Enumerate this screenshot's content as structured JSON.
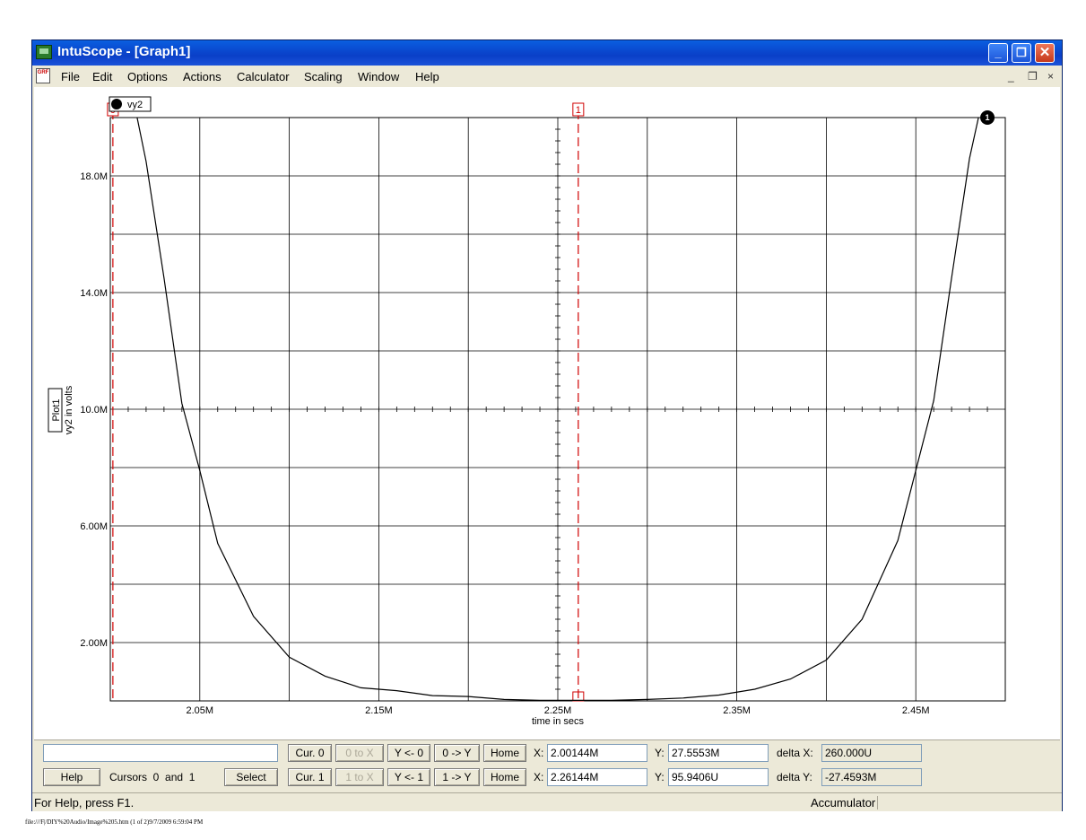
{
  "window": {
    "title": "IntuScope - [Graph1]",
    "controls": {
      "minimize": "_",
      "restore": "❐",
      "close": "✕"
    },
    "mdi_controls": {
      "minimize": "_",
      "restore": "❐",
      "close": "×"
    }
  },
  "menu": [
    "File",
    "Edit",
    "Options",
    "Actions",
    "Calculator",
    "Scaling",
    "Window",
    "Help"
  ],
  "graph": {
    "trace_label": "vy2",
    "trace_marker": "1",
    "plot_name": "Plot1",
    "y_axis_label": "vy2 in volts",
    "x_axis_label": "time in secs",
    "cursor0_label": "0",
    "cursor1_label": "1"
  },
  "chart_data": {
    "type": "line",
    "xlabel": "time in secs",
    "ylabel": "vy2 in volts",
    "xlim": [
      2.0,
      2.5
    ],
    "ylim": [
      0,
      20.0
    ],
    "x_tick_labels": [
      "2.05M",
      "2.15M",
      "2.25M",
      "2.35M",
      "2.45M"
    ],
    "x_tick_values": [
      2.05,
      2.15,
      2.25,
      2.35,
      2.45
    ],
    "y_tick_labels": [
      "2.00M",
      "6.00M",
      "10.0M",
      "14.0M",
      "18.0M"
    ],
    "y_tick_values": [
      2.0,
      6.0,
      10.0,
      14.0,
      18.0
    ],
    "grid": true,
    "series": [
      {
        "name": "vy2",
        "x": [
          2.015,
          2.02,
          2.03,
          2.04,
          2.05,
          2.06,
          2.08,
          2.1,
          2.12,
          2.14,
          2.16,
          2.18,
          2.2,
          2.22,
          2.24,
          2.26,
          2.28,
          2.3,
          2.32,
          2.34,
          2.36,
          2.38,
          2.4,
          2.42,
          2.44,
          2.45,
          2.46,
          2.47,
          2.48,
          2.485
        ],
        "y": [
          20.0,
          18.5,
          14.5,
          10.2,
          7.9,
          5.4,
          2.9,
          1.5,
          0.85,
          0.45,
          0.35,
          0.18,
          0.15,
          0.05,
          0.02,
          0.02,
          0.02,
          0.05,
          0.1,
          0.2,
          0.4,
          0.75,
          1.4,
          2.8,
          5.5,
          7.9,
          10.3,
          14.5,
          18.6,
          20.0
        ]
      }
    ],
    "cursors": [
      2.00144,
      2.26144
    ]
  },
  "controls_panel": {
    "expression_value": "",
    "help_label": "Help",
    "cursors_text": "Cursors  0  and  1",
    "select_label": "Select",
    "row0": {
      "cur_label": "Cur. 0",
      "to_x_label": "0 to X",
      "y_from_label": "Y <- 0",
      "to_y_label": "0 -> Y",
      "home_label": "Home",
      "x_label": "X:",
      "x_value": "2.00144M",
      "y_label": "Y:",
      "y_value": "27.5553M",
      "delta_label": "delta X:",
      "delta_value": "260.000U"
    },
    "row1": {
      "cur_label": "Cur. 1",
      "to_x_label": "1 to X",
      "y_from_label": "Y <- 1",
      "to_y_label": "1 -> Y",
      "home_label": "Home",
      "x_label": "X:",
      "x_value": "2.26144M",
      "y_label": "Y:",
      "y_value": "95.9406U",
      "delta_label": "delta Y:",
      "delta_value": "-27.4593M"
    }
  },
  "status": {
    "help_text": "For Help, press F1.",
    "accumulator": "Accumulator"
  },
  "footer": "file:///F|/DIY%20Audio/Image%205.htm (1 of 2)9/7/2009 6:59:04 PM"
}
